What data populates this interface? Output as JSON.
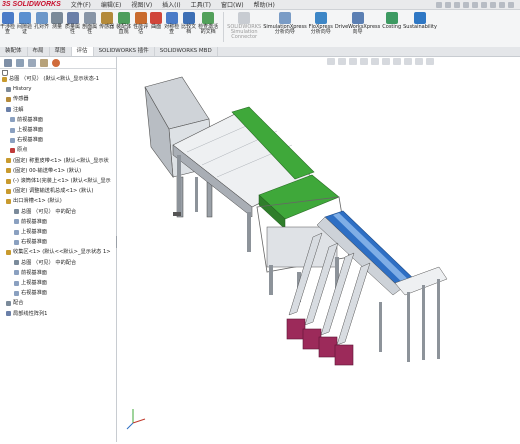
{
  "app": {
    "logo_prefix": "3S",
    "logo_name": "SOLIDWORKS"
  },
  "menu": [
    "文件(F)",
    "编辑(E)",
    "视图(V)",
    "插入(I)",
    "工具(T)",
    "窗口(W)",
    "帮助(H)"
  ],
  "ribbon": {
    "buttons": [
      {
        "label": "干涉检\n查",
        "color": "#4a7bc8"
      },
      {
        "label": "间隙验\n证",
        "color": "#5a8fd0"
      },
      {
        "label": "孔对齐",
        "color": "#6d97c9"
      },
      {
        "label": "测量",
        "color": "#7b8a99"
      },
      {
        "label": "质量属\n性",
        "color": "#6a7fa8"
      },
      {
        "label": "剖面属\n性",
        "color": "#8895a6"
      },
      {
        "label": "传感器",
        "color": "#b48a3a"
      },
      {
        "label": "装配体\n直观",
        "color": "#4e9e5c"
      },
      {
        "label": "性能评\n估",
        "color": "#c96b2e"
      },
      {
        "label": "曲面",
        "color": "#d0453a"
      },
      {
        "label": "对称检\n查",
        "color": "#4a7bc8"
      },
      {
        "label": "比较文\n档",
        "color": "#3d6fb5"
      },
      {
        "label": "检查激活\n的文档",
        "color": "#52a05a"
      }
    ],
    "sim_buttons": [
      {
        "label": "SOLIDWORKS\nSimulation\nConnector",
        "color": "#c8ccd2",
        "dim": true
      },
      {
        "label": "SimulationXpress\n分析向导",
        "color": "#7a9cc6",
        "dim": false
      },
      {
        "label": "FloXpress\n分析向导",
        "color": "#3d86c6",
        "dim": false
      },
      {
        "label": "DriveWorksXpress\n向导",
        "color": "#5b7fb3",
        "dim": false
      },
      {
        "label": "Costing",
        "color": "#3d9a62",
        "dim": false
      },
      {
        "label": "Sustainability",
        "color": "#2e77c4",
        "dim": false
      }
    ]
  },
  "tabs": [
    "装配体",
    "布局",
    "草图",
    "评估",
    "SOLIDWORKS 插件",
    "SOLIDWORKS MBD"
  ],
  "active_tab": 3,
  "tree": [
    {
      "text": "总图 （可见） (默认<默认_显示状态-1",
      "indent": 2,
      "color": "#c89a2e"
    },
    {
      "text": "History",
      "indent": 6,
      "color": "#7d8a99"
    },
    {
      "text": "传感器",
      "indent": 6,
      "color": "#b48a3a"
    },
    {
      "text": "注解",
      "indent": 6,
      "color": "#6a7fa8"
    },
    {
      "text": "前视基准面",
      "indent": 10,
      "color": "#8aa0c0"
    },
    {
      "text": "上视基准面",
      "indent": 10,
      "color": "#8aa0c0"
    },
    {
      "text": "右视基准面",
      "indent": 10,
      "color": "#8aa0c0"
    },
    {
      "text": "原点",
      "indent": 10,
      "color": "#c03a3a"
    },
    {
      "text": "(固定) 称重皮带<1> (默认<默认_显示状",
      "indent": 6,
      "color": "#c89a2e"
    },
    {
      "text": "(固定) 00-输送带<1> (默认)",
      "indent": 6,
      "color": "#c89a2e"
    },
    {
      "text": "(-) 滚筒体1(完装上<1> (默认<默认_显示",
      "indent": 6,
      "color": "#c89a2e"
    },
    {
      "text": "(固定) 调整输送机总成<1> (默认)",
      "indent": 6,
      "color": "#c89a2e"
    },
    {
      "text": "出口滑槽<1> (默认)",
      "indent": 6,
      "color": "#c89a2e"
    },
    {
      "text": "总图 （可见） 中的配合",
      "indent": 14,
      "color": "#7a8a9a"
    },
    {
      "text": "前视基准面",
      "indent": 14,
      "color": "#8aa0c0"
    },
    {
      "text": "上视基准面",
      "indent": 14,
      "color": "#8aa0c0"
    },
    {
      "text": "右视基准面",
      "indent": 14,
      "color": "#8aa0c0"
    },
    {
      "text": "收集区<1> (默认<<默认>_显示状态 1>",
      "indent": 6,
      "color": "#c89a2e"
    },
    {
      "text": "总图 （可见） 中的配合",
      "indent": 14,
      "color": "#7a8a9a"
    },
    {
      "text": "前视基准面",
      "indent": 14,
      "color": "#8aa0c0"
    },
    {
      "text": "上视基准面",
      "indent": 14,
      "color": "#8aa0c0"
    },
    {
      "text": "右视基准面",
      "indent": 14,
      "color": "#8aa0c0"
    },
    {
      "text": "配合",
      "indent": 6,
      "color": "#7a8a9a"
    },
    {
      "text": "局部线性阵列1",
      "indent": 6,
      "color": "#6a7fa8"
    }
  ],
  "colors": {
    "accent": "#c8102e",
    "belt_green": "#3fa83a",
    "bin_magenta": "#9c2a5a",
    "belt_blue": "#2e6fc4"
  }
}
